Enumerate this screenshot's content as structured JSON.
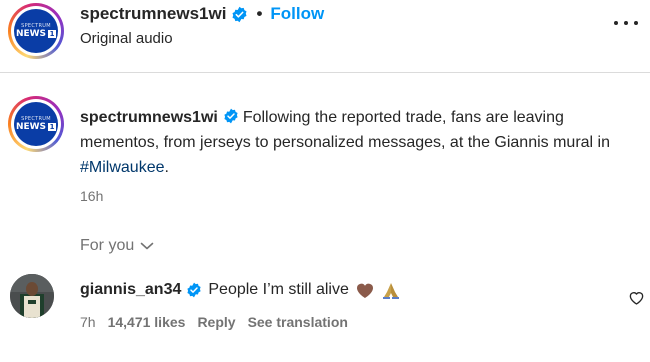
{
  "header": {
    "username": "spectrumnews1wi",
    "separator": "•",
    "follow_label": "Follow",
    "subtitle": "Original audio",
    "more_icon": "more-horizontal-icon"
  },
  "logo": {
    "small_text": "SPECTRUM",
    "large_text": "NEWS",
    "box_text": "1"
  },
  "caption": {
    "username": "spectrumnews1wi",
    "text": "Following the reported trade, fans are leaving mementos, from jerseys to personalized messages, at the Giannis mural in ",
    "hashtag": "#Milwaukee",
    "end": ".",
    "time": "16h"
  },
  "for_you": {
    "label": "For you"
  },
  "comment": {
    "username": "giannis_an34",
    "text": "People I’m still alive",
    "emojis": [
      "brown-heart-emoji",
      "folded-hands-emoji"
    ],
    "time": "7h",
    "likes": "14,471 likes",
    "reply_label": "Reply",
    "translation_label": "See translation"
  },
  "colors": {
    "link_blue": "#0095f6",
    "hashtag_blue": "#00376b",
    "secondary_text": "#737373",
    "brand_blue": "#0a3da6"
  }
}
